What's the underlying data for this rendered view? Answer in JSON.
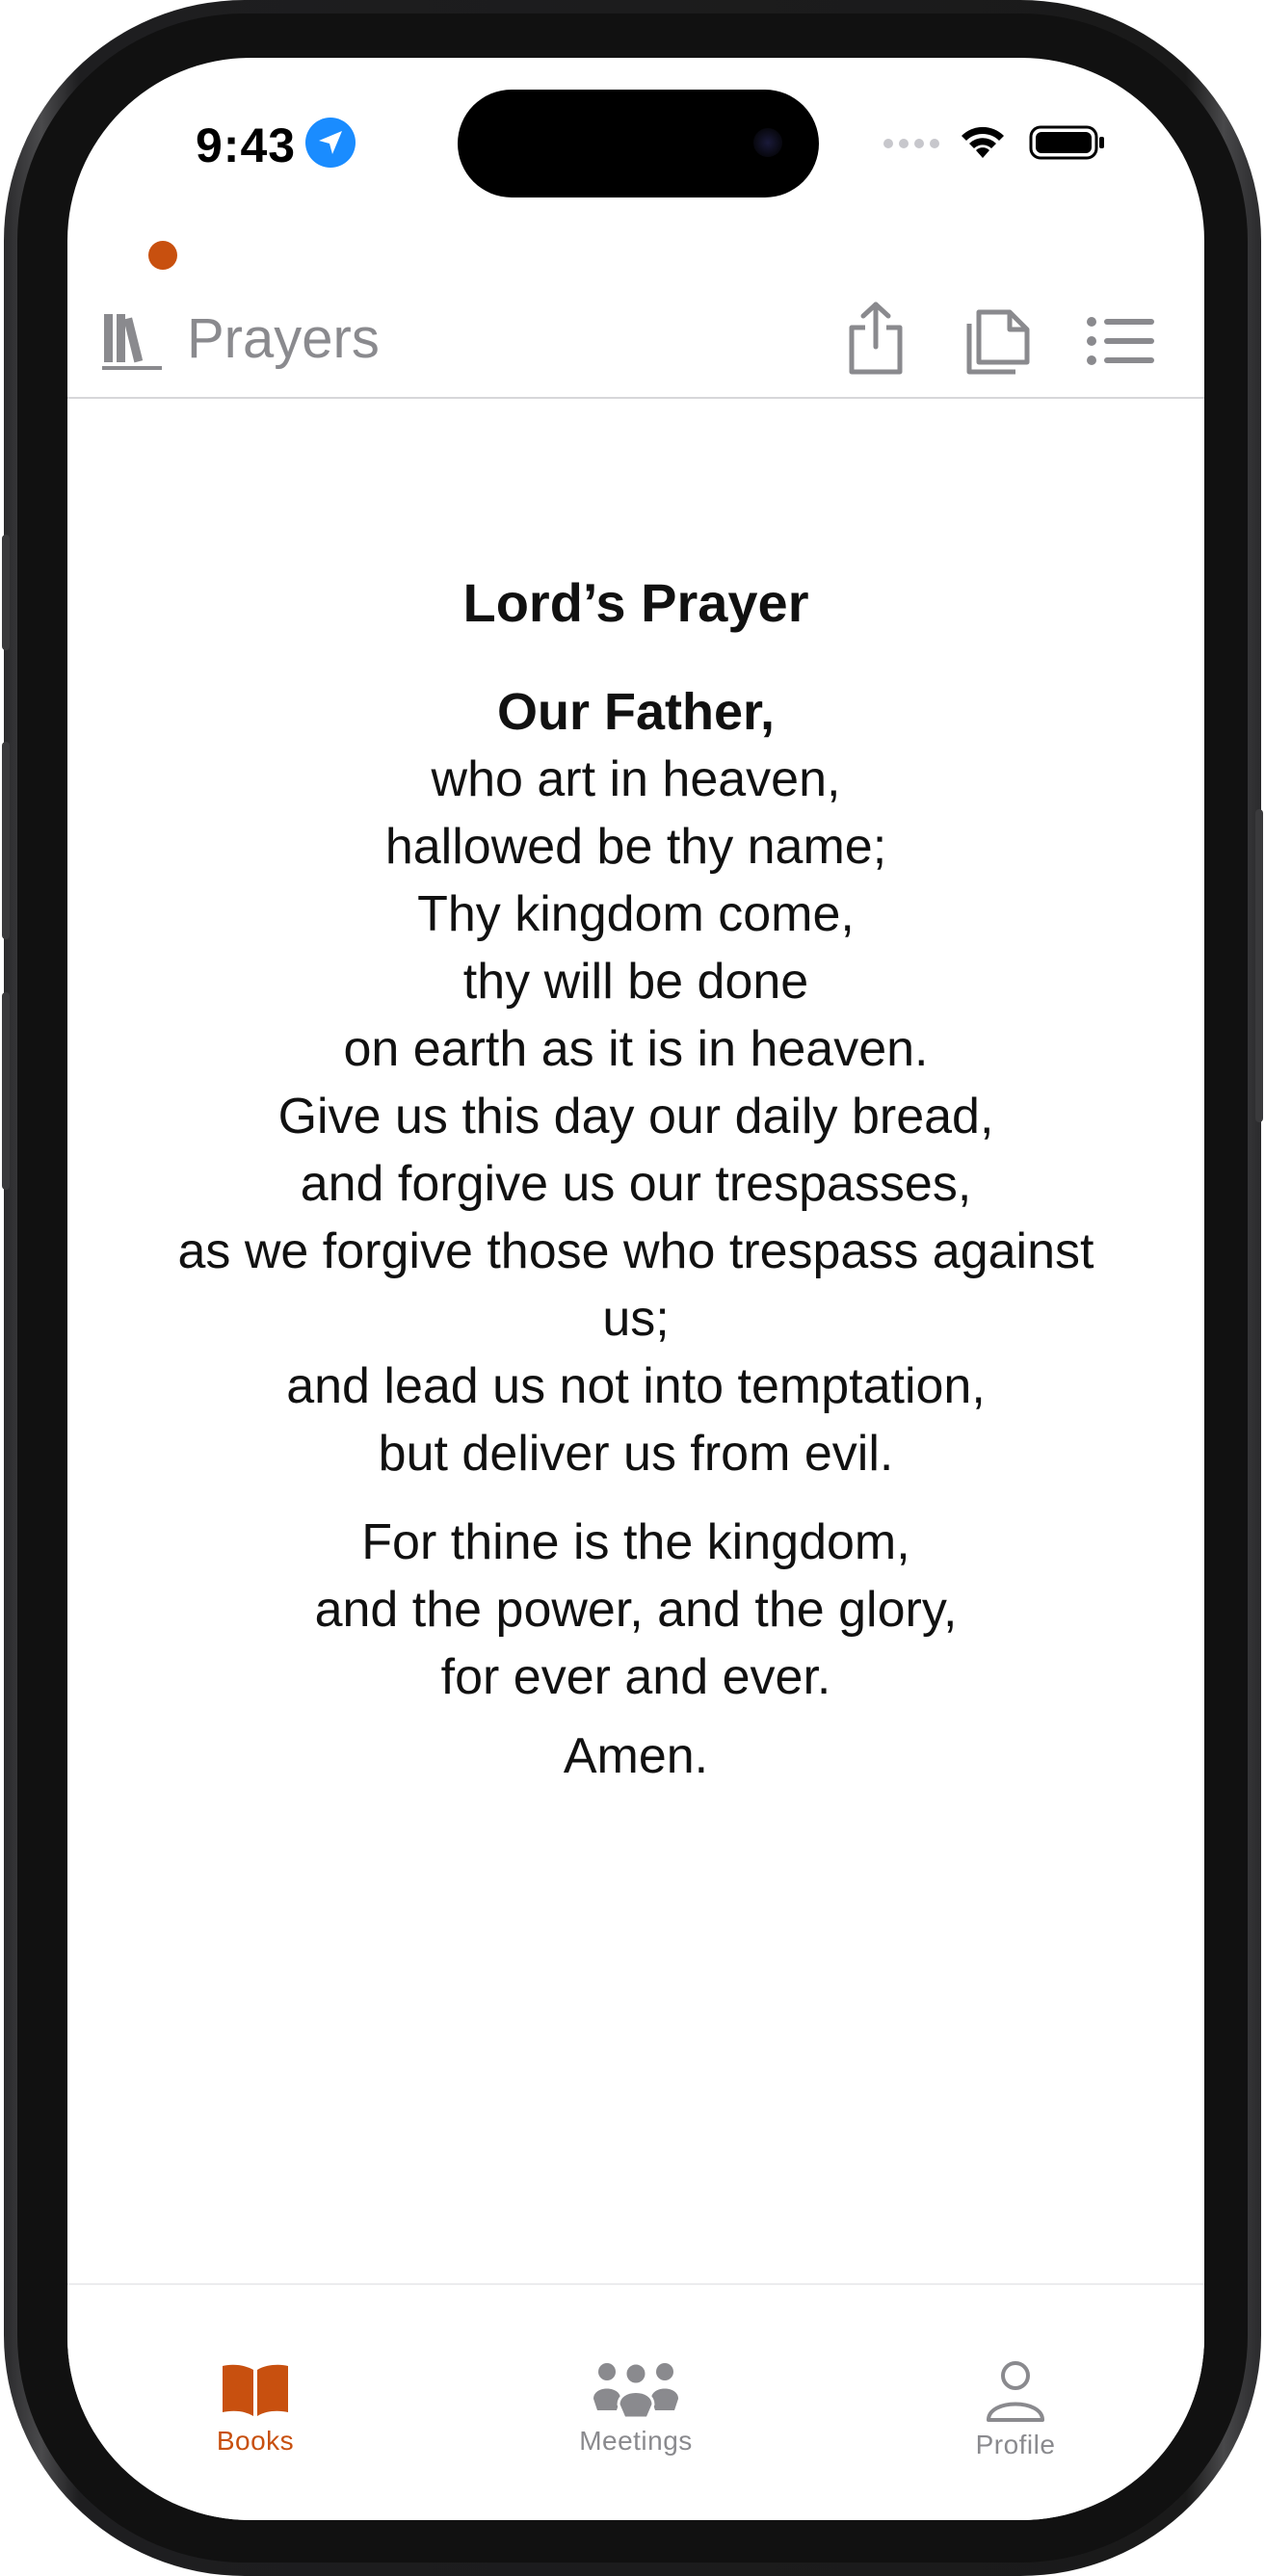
{
  "status_bar": {
    "time": "9:43"
  },
  "nav": {
    "title": "Prayers",
    "icons": [
      "books-icon",
      "share-icon",
      "pages-icon",
      "list-icon"
    ]
  },
  "prayer": {
    "title": "Lord’s Prayer",
    "opening": "Our Father,",
    "lines_1": [
      "who art in heaven,",
      "hallowed be thy name;",
      "Thy kingdom come,",
      "thy will be done",
      "on earth as it is in heaven.",
      "Give us this day our daily bread,",
      "and forgive us our trespasses,",
      "as we forgive those who trespass against",
      "us;",
      "and lead us not into temptation,",
      "but deliver us from evil."
    ],
    "lines_2": [
      "For thine is the kingdom,",
      "and the power, and the glory,",
      "for ever and ever."
    ],
    "closing": "Amen."
  },
  "tab_bar": {
    "tabs": [
      {
        "label": "Books",
        "icon": "open-book-icon",
        "active": true
      },
      {
        "label": "Meetings",
        "icon": "people-icon",
        "active": false
      },
      {
        "label": "Profile",
        "icon": "person-icon",
        "active": false
      }
    ]
  },
  "colors": {
    "accent": "#c8500f",
    "inactive": "#8a8a8e",
    "text": "#111111",
    "location_blue": "#1a8cff"
  }
}
